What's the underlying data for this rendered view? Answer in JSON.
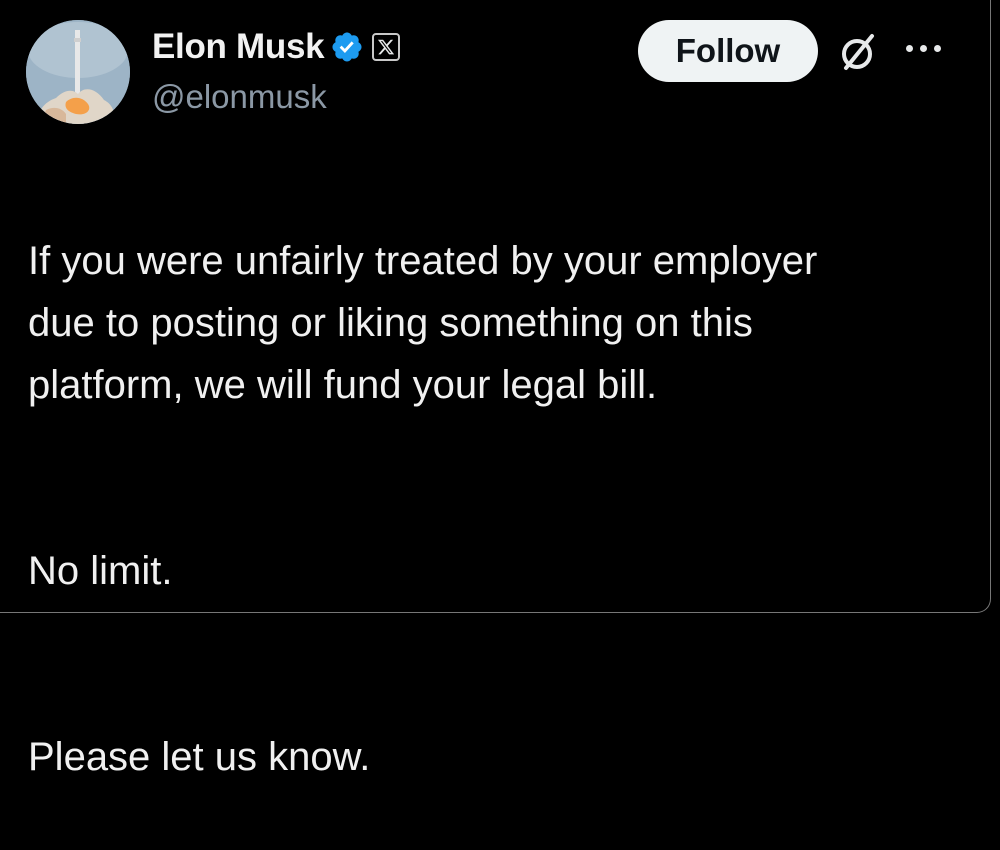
{
  "author": {
    "name": "Elon Musk",
    "handle": "@elonmusk",
    "verified_color": "#1d9bf0"
  },
  "header": {
    "follow_label": "Follow",
    "icons": [
      "verified-badge-icon",
      "x-logo-icon",
      "grok-icon",
      "more-options-icon"
    ]
  },
  "tweet": {
    "paragraphs": [
      "If you were unfairly treated by your employer\ndue to posting or liking something on this\nplatform, we will fund your legal bill.",
      "No limit.",
      "Please let us know."
    ]
  },
  "colors": {
    "background": "#000000",
    "text": "#e7e9ea",
    "secondary_text": "#8b98a5",
    "button_bg": "#eff3f4"
  }
}
